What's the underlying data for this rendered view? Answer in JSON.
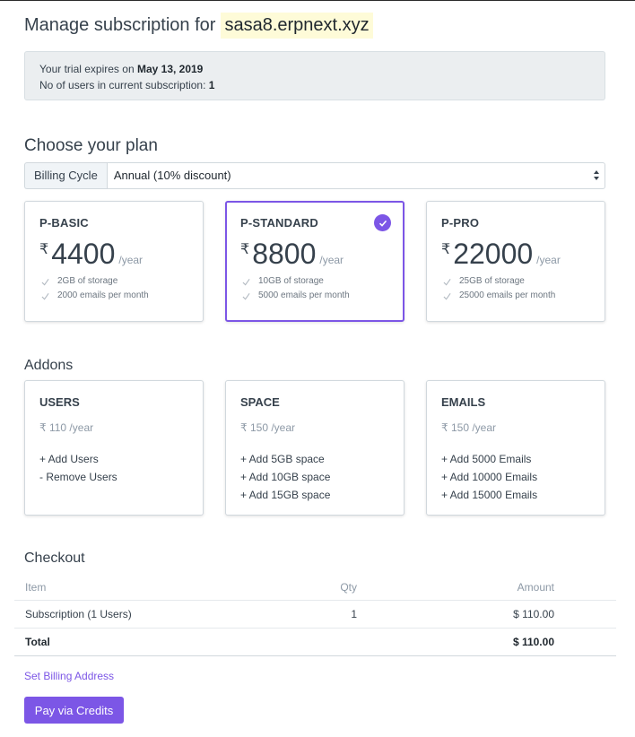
{
  "header": {
    "title": "Manage subscription for",
    "site": "sasa8.erpnext.xyz"
  },
  "trial": {
    "expires_prefix": "Your trial expires on",
    "expires_date": "May 13, 2019",
    "users_prefix": "No of users in current subscription:",
    "users_count": "1"
  },
  "plans_section": {
    "title": "Choose your plan",
    "billing_label": "Billing Cycle",
    "billing_value": "Annual (10% discount)",
    "plans": [
      {
        "name": "P-BASIC",
        "currency": "₹",
        "amount": "4400",
        "period": "/year",
        "features": [
          "2GB of storage",
          "2000 emails per month"
        ],
        "selected": false
      },
      {
        "name": "P-STANDARD",
        "currency": "₹",
        "amount": "8800",
        "period": "/year",
        "features": [
          "10GB of storage",
          "5000 emails per month"
        ],
        "selected": true
      },
      {
        "name": "P-PRO",
        "currency": "₹",
        "amount": "22000",
        "period": "/year",
        "features": [
          "25GB of storage",
          "25000 emails per month"
        ],
        "selected": false
      }
    ]
  },
  "addons_section": {
    "title": "Addons",
    "addons": [
      {
        "name": "USERS",
        "price": "₹ 110 /year",
        "actions": [
          "+ Add Users",
          "- Remove Users"
        ]
      },
      {
        "name": "SPACE",
        "price": "₹ 150 /year",
        "actions": [
          "+ Add 5GB space",
          "+ Add 10GB space",
          "+ Add 15GB space"
        ]
      },
      {
        "name": "EMAILS",
        "price": "₹ 150 /year",
        "actions": [
          "+ Add 5000 Emails",
          "+ Add 10000 Emails",
          "+ Add 15000 Emails"
        ]
      }
    ]
  },
  "checkout": {
    "title": "Checkout",
    "columns": [
      "Item",
      "Qty",
      "Amount"
    ],
    "rows": [
      {
        "item": "Subscription (1 Users)",
        "qty": "1",
        "amount": "$ 110.00"
      }
    ],
    "total_label": "Total",
    "total_amount": "$ 110.00",
    "billing_link": "Set Billing Address",
    "pay_button": "Pay via Credits"
  },
  "colors": {
    "accent": "#7c56e6",
    "site_highlight": "#fefbd8",
    "alert_bg": "#ebeef0"
  }
}
